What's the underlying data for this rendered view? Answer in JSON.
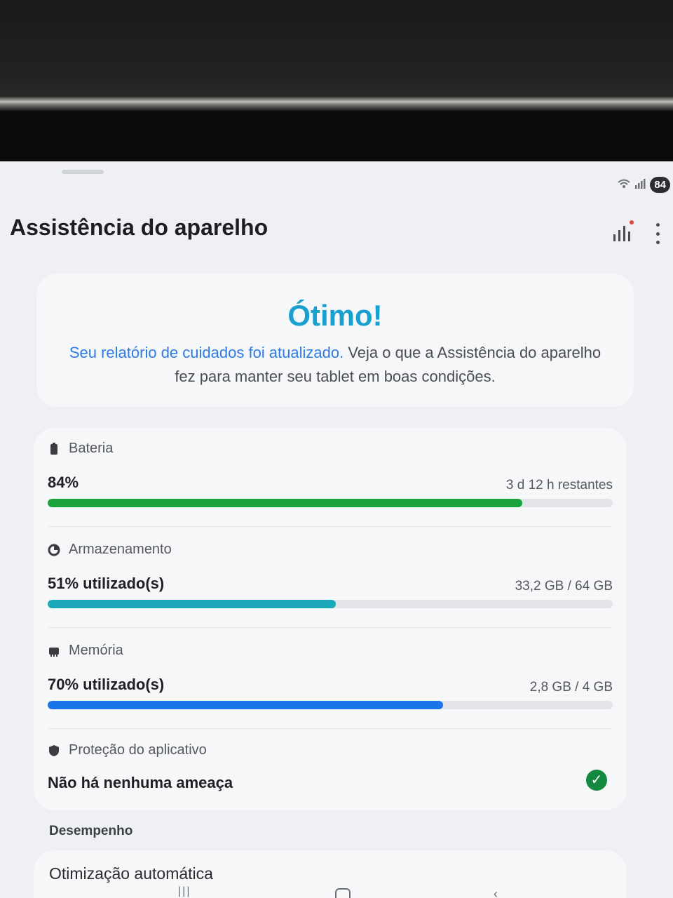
{
  "status": {
    "battery_level": "84"
  },
  "header": {
    "title": "Assistência do aparelho"
  },
  "summary": {
    "title": "Ótimo!",
    "link_text": "Seu relatório de cuidados foi atualizado.",
    "body_text": " Veja o que a Assistência do aparelho fez para manter seu tablet em boas condições."
  },
  "battery": {
    "label": "Bateria",
    "value": "84%",
    "detail": "3 d 12 h restantes",
    "fill_percent": 84,
    "color": "#1aa23c"
  },
  "storage": {
    "label": "Armazenamento",
    "value": "51% utilizado(s)",
    "detail": "33,2 GB / 64 GB",
    "fill_percent": 51,
    "color": "#1aa7b8"
  },
  "memory": {
    "label": "Memória",
    "value": "70% utilizado(s)",
    "detail": "2,8 GB / 4 GB",
    "fill_percent": 70,
    "color": "#1a73e8"
  },
  "protection": {
    "label": "Proteção do aplicativo",
    "value": "Não há nenhuma ameaça"
  },
  "performance": {
    "section_title": "Desempenho",
    "item_label": "Otimização automática"
  }
}
